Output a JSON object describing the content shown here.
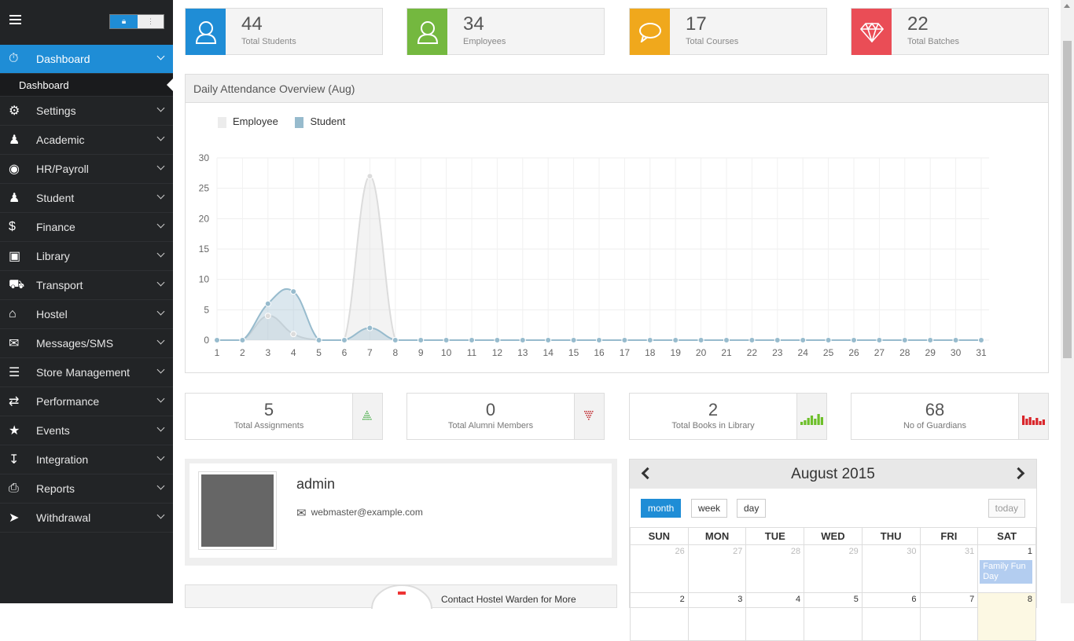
{
  "sidebar": {
    "items": [
      {
        "label": "Dashboard",
        "icon": "dashboard-icon"
      },
      {
        "label": "Settings",
        "icon": "cogs-icon"
      },
      {
        "label": "Academic",
        "icon": "users-icon"
      },
      {
        "label": "HR/Payroll",
        "icon": "eye-icon"
      },
      {
        "label": "Student",
        "icon": "user-icon"
      },
      {
        "label": "Finance",
        "icon": "dollar-icon"
      },
      {
        "label": "Library",
        "icon": "book-icon"
      },
      {
        "label": "Transport",
        "icon": "truck-icon"
      },
      {
        "label": "Hostel",
        "icon": "home-icon"
      },
      {
        "label": "Messages/SMS",
        "icon": "envelope-icon"
      },
      {
        "label": "Store Management",
        "icon": "tasks-icon"
      },
      {
        "label": "Performance",
        "icon": "random-icon"
      },
      {
        "label": "Events",
        "icon": "star-icon"
      },
      {
        "label": "Integration",
        "icon": "import-icon"
      },
      {
        "label": "Reports",
        "icon": "print-icon"
      },
      {
        "label": "Withdrawal",
        "icon": "send-icon"
      }
    ],
    "sub_item": "Dashboard"
  },
  "stats": [
    {
      "value": "44",
      "label": "Total Students",
      "color": "#1f8dd6",
      "icon": "user-icon"
    },
    {
      "value": "34",
      "label": "Employees",
      "color": "#74b83f",
      "icon": "user-icon"
    },
    {
      "value": "17",
      "label": "Total Courses",
      "color": "#f0a81c",
      "icon": "chat-icon"
    },
    {
      "value": "22",
      "label": "Total Batches",
      "color": "#ea4d56",
      "icon": "diamond-icon"
    }
  ],
  "attendance": {
    "title": "Daily Attendance Overview  (Aug)",
    "chart_data": {
      "type": "area",
      "x": [
        1,
        2,
        3,
        4,
        5,
        6,
        7,
        8,
        9,
        10,
        11,
        12,
        13,
        14,
        15,
        16,
        17,
        18,
        19,
        20,
        21,
        22,
        23,
        24,
        25,
        26,
        27,
        28,
        29,
        30,
        31
      ],
      "ylim": [
        0,
        30
      ],
      "yticks": [
        0,
        5,
        10,
        15,
        20,
        25,
        30
      ],
      "series": [
        {
          "name": "Employee",
          "color": "#dcdcdc",
          "values": [
            0,
            0,
            4,
            1,
            0,
            0,
            27,
            0,
            0,
            0,
            0,
            0,
            0,
            0,
            0,
            0,
            0,
            0,
            0,
            0,
            0,
            0,
            0,
            0,
            0,
            0,
            0,
            0,
            0,
            0,
            0
          ]
        },
        {
          "name": "Student",
          "color": "#97bbcd",
          "values": [
            0,
            0,
            6,
            8,
            0,
            0,
            2,
            0,
            0,
            0,
            0,
            0,
            0,
            0,
            0,
            0,
            0,
            0,
            0,
            0,
            0,
            0,
            0,
            0,
            0,
            0,
            0,
            0,
            0,
            0,
            0
          ]
        }
      ]
    }
  },
  "mini_stats": [
    {
      "value": "5",
      "label": "Total Assignments",
      "color": "#3aa83a"
    },
    {
      "value": "0",
      "label": "Total Alumni Members",
      "color": "#c0262c"
    },
    {
      "value": "2",
      "label": "Total Books in Library",
      "color": "#6dbf29"
    },
    {
      "value": "68",
      "label": "No of Guardians",
      "color": "#d9252a"
    }
  ],
  "profile": {
    "name": "admin",
    "email": "webmaster@example.com"
  },
  "hostel": {
    "text": "Contact Hostel Warden for More"
  },
  "calendar": {
    "title": "August 2015",
    "buttons": {
      "month": "month",
      "week": "week",
      "day": "day",
      "today": "today"
    },
    "days": [
      "SUN",
      "MON",
      "TUE",
      "WED",
      "THU",
      "FRI",
      "SAT"
    ],
    "row1": [
      "26",
      "27",
      "28",
      "29",
      "30",
      "31",
      "1"
    ],
    "row2": [
      "2",
      "3",
      "4",
      "5",
      "6",
      "7",
      "8"
    ],
    "event": "Family Fun Day"
  }
}
